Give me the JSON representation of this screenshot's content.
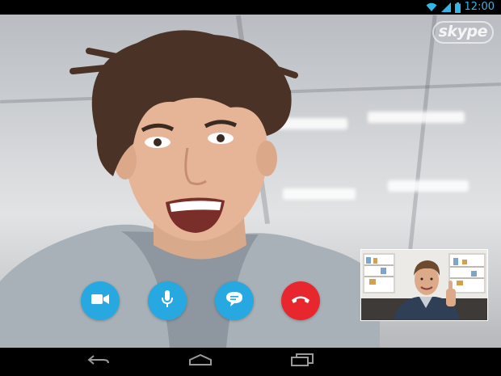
{
  "status_bar": {
    "time": "12:00",
    "icons": [
      "wifi-icon",
      "signal-icon",
      "battery-icon"
    ],
    "accent_color": "#33b5e5"
  },
  "app": {
    "logo_text": "skype"
  },
  "call_controls": [
    {
      "name": "video-toggle-button",
      "icon": "video-camera-icon",
      "color": "#27a8e0"
    },
    {
      "name": "mute-button",
      "icon": "microphone-icon",
      "color": "#27a8e0"
    },
    {
      "name": "chat-button",
      "icon": "chat-bubble-icon",
      "color": "#27a8e0"
    },
    {
      "name": "end-call-button",
      "icon": "hang-up-icon",
      "color": "#e8262d"
    }
  ],
  "navigation": {
    "buttons": [
      "back-icon",
      "home-icon",
      "recent-apps-icon"
    ]
  }
}
